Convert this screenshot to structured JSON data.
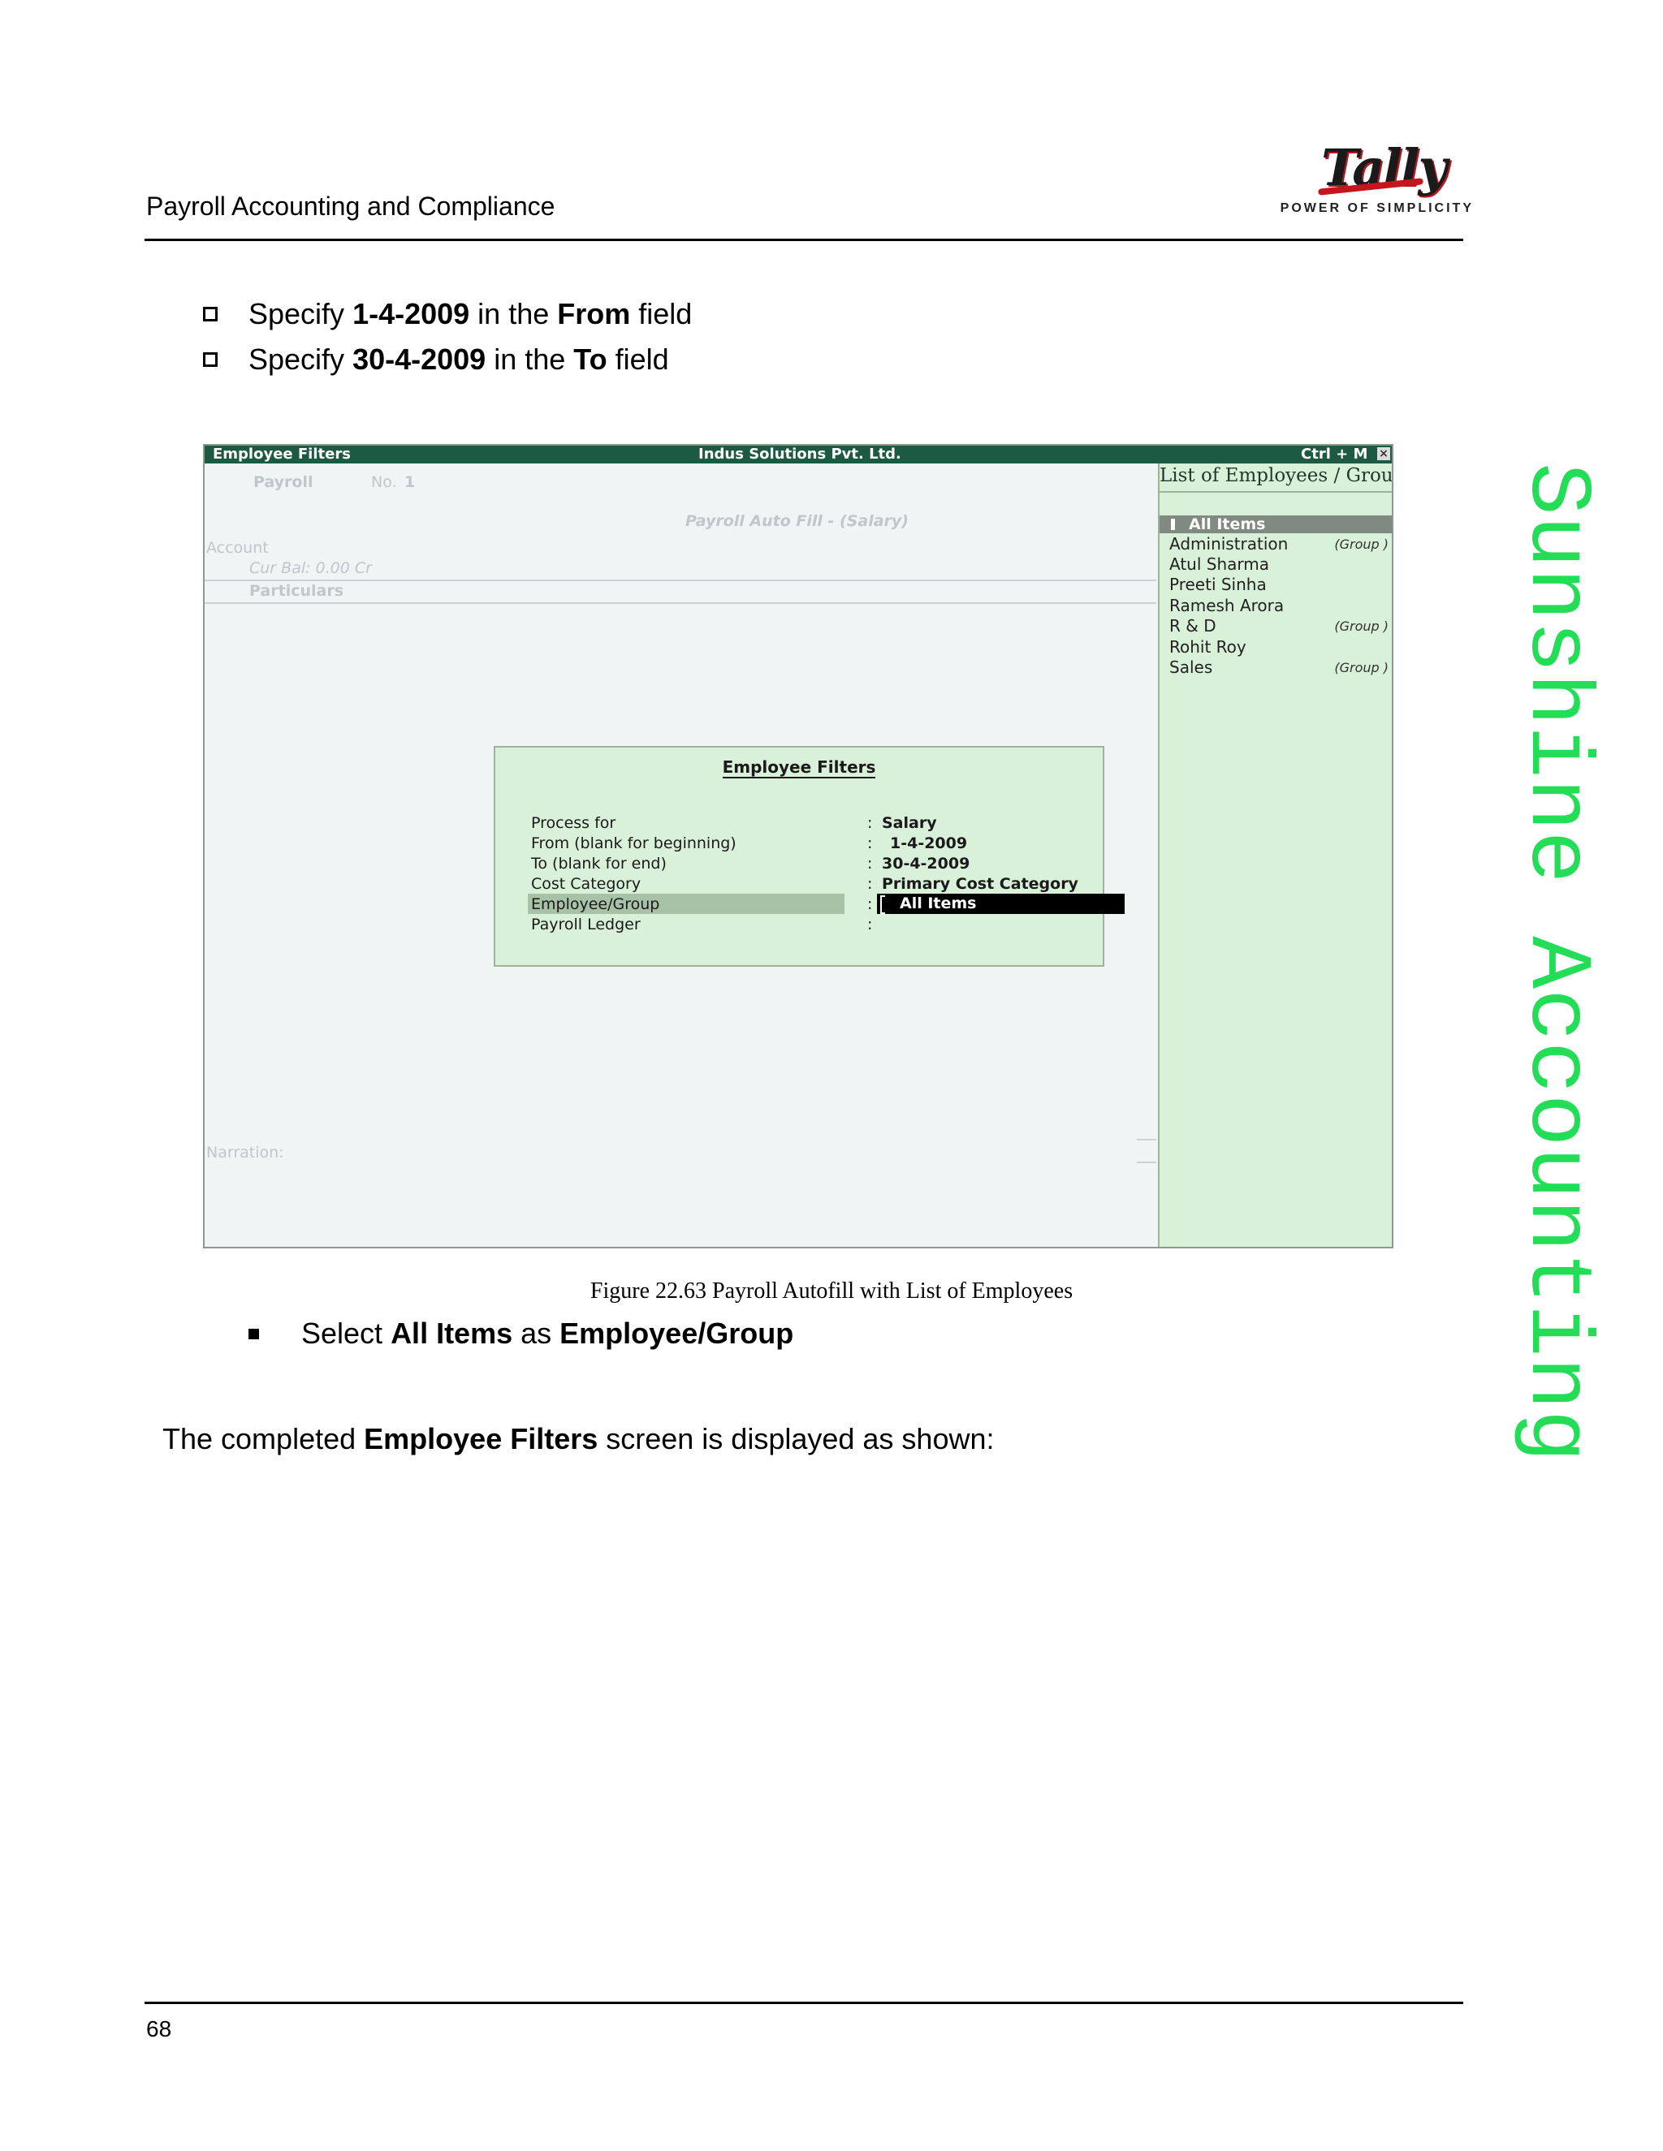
{
  "header": {
    "title": "Payroll Accounting and Compliance",
    "logo_text": "Tally",
    "logo_tagline": "POWER OF SIMPLICITY"
  },
  "bullets_top": [
    {
      "pre": "Specify ",
      "b1": "1-4-2009",
      "mid": " in the ",
      "b2": "From",
      "post": " field"
    },
    {
      "pre": "Specify ",
      "b1": "30-4-2009",
      "mid": " in the ",
      "b2": "To",
      "post": " field"
    }
  ],
  "screenshot": {
    "title_left": "Employee Filters",
    "title_center": "Indus Solutions Pvt. Ltd.",
    "title_right": "Ctrl + M",
    "close": "×",
    "bg": {
      "payroll": "Payroll",
      "no_label": "No.",
      "no_value": "1",
      "autofill": "Payroll Auto Fill - (Salary)",
      "account": "Account",
      "cur_bal": "Cur Bal:  0.00 Cr",
      "particulars": "Particulars",
      "narration": "Narration:"
    },
    "list": {
      "title": "List of Employees / Group",
      "selected": "All Items",
      "items": [
        {
          "name": "Administration",
          "tag": "(Group )"
        },
        {
          "name": "Atul Sharma",
          "tag": ""
        },
        {
          "name": "Preeti Sinha",
          "tag": ""
        },
        {
          "name": "Ramesh Arora",
          "tag": ""
        },
        {
          "name": "R & D",
          "tag": "(Group )"
        },
        {
          "name": "Rohit Roy",
          "tag": ""
        },
        {
          "name": "Sales",
          "tag": "(Group )"
        }
      ]
    },
    "dialog": {
      "title": "Employee Filters",
      "rows": [
        {
          "label": "Process for",
          "value": "Salary"
        },
        {
          "label": "From (blank for beginning)",
          "value": "1-4-2009"
        },
        {
          "label": "To (blank for end)",
          "value": "30-4-2009"
        },
        {
          "label": "Cost Category",
          "value": "Primary Cost Category"
        },
        {
          "label": "Employee/Group",
          "value": "All Items"
        },
        {
          "label": "Payroll Ledger",
          "value": ""
        }
      ]
    }
  },
  "caption": "Figure 22.63  Payroll Autofill with List of Employees",
  "bullet_select": {
    "pre": "Select ",
    "b1": "All Items",
    "mid": " as ",
    "b2": "Employee/Group"
  },
  "paragraph": {
    "pre": "The completed ",
    "b": "Employee Filters",
    "post": " screen is displayed as shown:"
  },
  "watermark": "Sunshine Accounting",
  "footer": {
    "page_number": "68"
  },
  "colors": {
    "watermark": "#22dd55",
    "titlebar": "#1d5a44",
    "panel": "#d9f0d9"
  }
}
